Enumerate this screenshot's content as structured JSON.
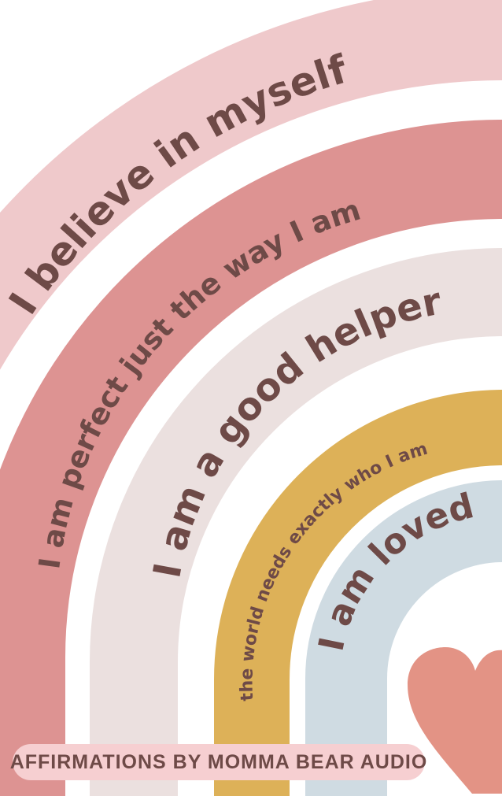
{
  "colors": {
    "background": "#ffffff",
    "band_outer": "#efc9cb",
    "band_second": "#dd9392",
    "band_third": "#ebe0df",
    "band_fourth": "#ddb158",
    "band_inner": "#cfdbe2",
    "text": "#6e4a47",
    "heart": "#e39385",
    "footer_bg": "#f6cfd1"
  },
  "affirmations": {
    "outer": "I believe in myself",
    "second": "I am perfect just the way I am",
    "third": "I am a good helper",
    "fourth": "the world needs exactly who I am",
    "inner": "I am loved"
  },
  "decoration": {
    "icon": "heart-icon"
  },
  "footer": {
    "credit": "AFFIRMATIONS BY MOMMA BEAR AUDIO"
  }
}
